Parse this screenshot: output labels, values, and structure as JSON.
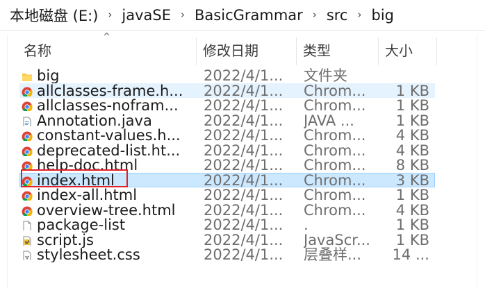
{
  "breadcrumb": [
    "本地磁盘 (E:)",
    "javaSE",
    "BasicGrammar",
    "src",
    "big"
  ],
  "breadcrumb_separator": "›",
  "columns": {
    "name": "名称",
    "date": "修改日期",
    "type": "类型",
    "size": "大小"
  },
  "sort_indicator": "^",
  "files": [
    {
      "icon": "folder-icon",
      "name": "big",
      "date": "2022/4/1...",
      "type": "文件夹",
      "size": ""
    },
    {
      "icon": "chrome-icon",
      "name": "allclasses-frame.h...",
      "date": "2022/4/1...",
      "type": "Chrom...",
      "size": "1 KB"
    },
    {
      "icon": "chrome-icon",
      "name": "allclasses-nofram...",
      "date": "2022/4/1...",
      "type": "Chrom...",
      "size": "1 KB"
    },
    {
      "icon": "java-file-icon",
      "name": "Annotation.java",
      "date": "2022/4/1...",
      "type": "JAVA ...",
      "size": "1 KB"
    },
    {
      "icon": "chrome-icon",
      "name": "constant-values.h...",
      "date": "2022/4/1...",
      "type": "Chrom...",
      "size": "4 KB"
    },
    {
      "icon": "chrome-icon",
      "name": "deprecated-list.ht...",
      "date": "2022/4/1...",
      "type": "Chrom...",
      "size": "4 KB"
    },
    {
      "icon": "chrome-icon",
      "name": "help-doc.html",
      "date": "2022/4/1...",
      "type": "Chrom...",
      "size": "8 KB"
    },
    {
      "icon": "chrome-icon",
      "name": "index.html",
      "date": "2022/4/1...",
      "type": "Chrom...",
      "size": "3 KB"
    },
    {
      "icon": "chrome-icon",
      "name": "index-all.html",
      "date": "2022/4/1...",
      "type": "Chrom...",
      "size": "1 KB"
    },
    {
      "icon": "chrome-icon",
      "name": "overview-tree.html",
      "date": "2022/4/1...",
      "type": "Chrom...",
      "size": "4 KB"
    },
    {
      "icon": "blank-file-icon",
      "name": "package-list",
      "date": "2022/4/1...",
      "type": ".",
      "size": "1 KB"
    },
    {
      "icon": "js-file-icon",
      "name": "script.js",
      "date": "2022/4/1...",
      "type": "JavaScr...",
      "size": "1 KB"
    },
    {
      "icon": "css-file-icon",
      "name": "stylesheet.css",
      "date": "2022/4/1...",
      "type": "层叠样...",
      "size": "14 ..."
    }
  ],
  "selected_file": "index.html",
  "hovered_file": "allclasses-frame.h...",
  "colors": {
    "selection": "#cce8ff",
    "hover": "#e5f3ff",
    "annotation_box": "#e0202a"
  }
}
